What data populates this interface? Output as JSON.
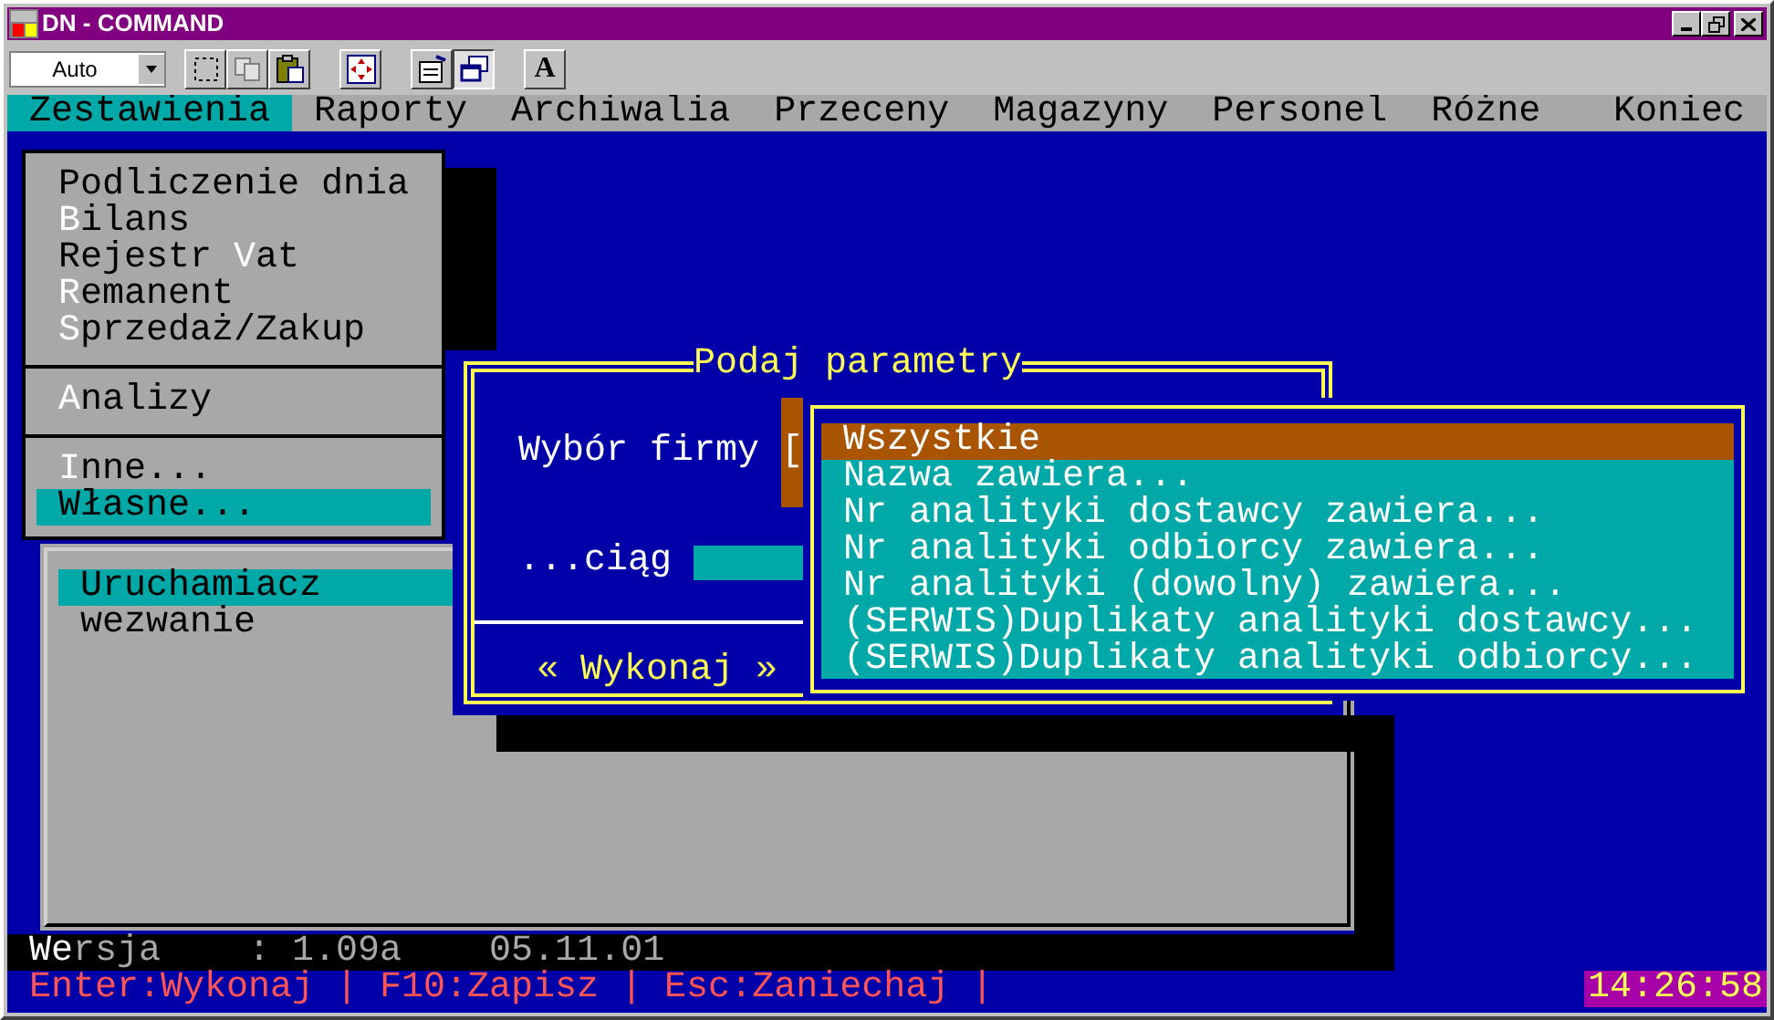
{
  "window": {
    "title": "DN - COMMAND"
  },
  "toolbar": {
    "combo": "Auto",
    "font_button": "A"
  },
  "menu_bar": [
    {
      "label": "Zestawienia",
      "selected": true
    },
    {
      "label": "Raporty",
      "selected": false
    },
    {
      "label": "Archiwalia",
      "selected": false
    },
    {
      "label": "Przeceny",
      "selected": false
    },
    {
      "label": "Magazyny",
      "selected": false
    },
    {
      "label": "Personel",
      "selected": false
    },
    {
      "label": "Różne",
      "selected": false
    },
    {
      "label": "Koniec",
      "selected": false
    }
  ],
  "dropdown": {
    "groups": [
      [
        {
          "before": "Podliczenie dnia",
          "selected": false
        },
        {
          "key": "B",
          "after": "ilans",
          "selected": false
        },
        {
          "before": "Rejestr ",
          "key": "V",
          "after": "at",
          "selected": false
        },
        {
          "key": "R",
          "after": "emanent",
          "selected": false
        },
        {
          "key": "S",
          "after": "przedaż/Zakup",
          "selected": false
        }
      ],
      [
        {
          "key": "A",
          "after": "nalizy",
          "selected": false
        }
      ],
      [
        {
          "key": "I",
          "after": "nne...",
          "selected": false
        },
        {
          "before": "Własne...",
          "selected": true
        }
      ]
    ]
  },
  "submenu": [
    {
      "label": "Uruchamiacz",
      "selected": true
    },
    {
      "label": "wezwanie",
      "selected": false
    }
  ],
  "dialog": {
    "title": "Podaj parametry",
    "fields": [
      {
        "kind": "select",
        "label": "Wybór firmy",
        "value": "["
      },
      {
        "kind": "text",
        "label": "...ciąg"
      }
    ],
    "button": "« Wykonaj »"
  },
  "list": [
    {
      "label": "Wszystkie",
      "selected": true
    },
    {
      "label": "Nazwa zawiera...",
      "selected": false
    },
    {
      "label": "Nr analityki dostawcy zawiera...",
      "selected": false
    },
    {
      "label": "Nr analityki odbiorcy zawiera...",
      "selected": false
    },
    {
      "label": "Nr analityki (dowolny) zawiera...",
      "selected": false
    },
    {
      "label": "(SERWIS)Duplikaty analityki dostawcy...",
      "selected": false
    },
    {
      "label": "(SERWIS)Duplikaty analityki odbiorcy...",
      "selected": false
    }
  ],
  "version_line": {
    "key": "We",
    "rest": "rsja    : 1.09a    05.11.01"
  },
  "status_bar": {
    "hints": "Enter:Wykonaj | F10:Zapisz | Esc:Zaniechaj |",
    "clock": "14:26:58"
  }
}
